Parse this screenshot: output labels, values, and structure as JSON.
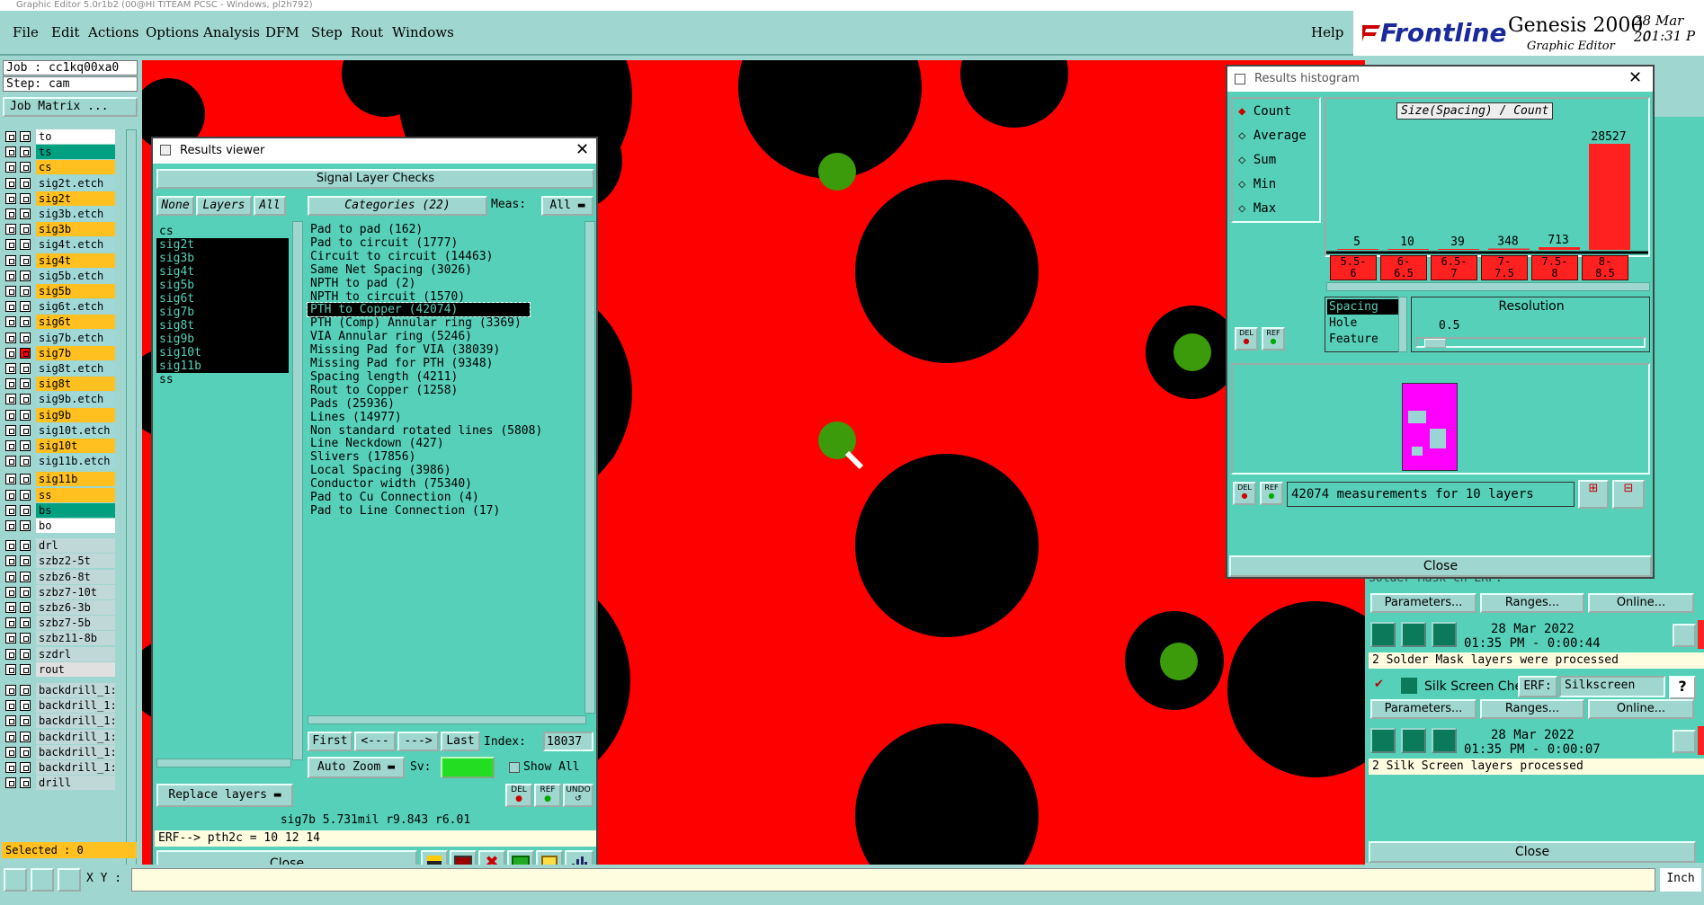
{
  "window_title": "Graphic Editor 5.0r1b2 (00@HI TITEAM PCSC - Windows, pl2h792)",
  "menu": [
    "File",
    "Edit",
    "Actions",
    "Options",
    "Analysis",
    "DFM",
    "Step",
    "Rout",
    "Windows"
  ],
  "help": "Help",
  "brand": {
    "logo": "Frontline",
    "product": "Genesis 2000",
    "subtitle": "Graphic Editor",
    "date": "28 Mar 20",
    "time": "01:31 P"
  },
  "job": {
    "job_label": "Job : cc1kq00xa0",
    "step_label": "Step: cam",
    "matrix_button": "Job Matrix ..."
  },
  "layers": [
    {
      "name": "to",
      "color": "#ffffff"
    },
    {
      "name": "ts",
      "color": "#00a080"
    },
    {
      "name": "cs",
      "color": "#ffc020"
    },
    {
      "name": "sig2t.etch",
      "color": "#a0d8d8"
    },
    {
      "name": "sig2t",
      "color": "#ffc020"
    },
    {
      "name": "sig3b.etch",
      "color": "#a0d8d8"
    },
    {
      "name": "sig3b",
      "color": "#ffc020"
    },
    {
      "name": "sig4t.etch",
      "color": "#a0d8d8"
    },
    {
      "name": "sig4t",
      "color": "#ffc020"
    },
    {
      "name": "sig5b.etch",
      "color": "#a0d8d8"
    },
    {
      "name": "sig5b",
      "color": "#ffc020"
    },
    {
      "name": "sig6t.etch",
      "color": "#a0d8d8"
    },
    {
      "name": "sig6t",
      "color": "#ffc020"
    },
    {
      "name": "sig7b.etch",
      "color": "#a0d8d8"
    },
    {
      "name": "sig7b",
      "color": "#ffc020"
    },
    {
      "name": "sig8t.etch",
      "color": "#a0d8d8"
    },
    {
      "name": "sig8t",
      "color": "#ffc020"
    },
    {
      "name": "sig9b.etch",
      "color": "#a0d8d8"
    },
    {
      "name": "sig9b",
      "color": "#ffc020"
    },
    {
      "name": "sig10t.etch",
      "color": "#a0d8d8"
    },
    {
      "name": "sig10t",
      "color": "#ffc020"
    },
    {
      "name": "sig11b.etch",
      "color": "#a0d8d8"
    },
    {
      "name": "sig11b",
      "color": "#ffc020"
    },
    {
      "name": "ss",
      "color": "#ffc020"
    },
    {
      "name": "bs",
      "color": "#00a080"
    },
    {
      "name": "bo",
      "color": "#ffffff"
    },
    {
      "name": "drl",
      "color": "#c0d8d8"
    },
    {
      "name": "szbz2-5t",
      "color": "#c0d8d8"
    },
    {
      "name": "szbz6-8t",
      "color": "#c0d8d8"
    },
    {
      "name": "szbz7-10t",
      "color": "#c0d8d8"
    },
    {
      "name": "szbz6-3b",
      "color": "#c0d8d8"
    },
    {
      "name": "szbz7-5b",
      "color": "#c0d8d8"
    },
    {
      "name": "szbz11-8b",
      "color": "#c0d8d8"
    },
    {
      "name": "szdrl",
      "color": "#c0d8d8"
    },
    {
      "name": "rout",
      "color": "#e0e0e0"
    },
    {
      "name": "backdrill_1:",
      "color": "#c0d8d8"
    },
    {
      "name": "backdrill_1:",
      "color": "#c0d8d8"
    },
    {
      "name": "backdrill_1:",
      "color": "#c0d8d8"
    },
    {
      "name": "backdrill_1:",
      "color": "#c0d8d8"
    },
    {
      "name": "backdrill_1:",
      "color": "#c0d8d8"
    },
    {
      "name": "backdrill_1:",
      "color": "#c0d8d8"
    },
    {
      "name": "drill",
      "color": "#c0d8d8"
    }
  ],
  "selected": "Selected : 0",
  "xy_label": "X Y :",
  "results_viewer": {
    "title": "Results viewer",
    "header": "Signal Layer Checks",
    "none_btn": "None",
    "layers_btn": "Layers",
    "all_btn": "All",
    "categories_btn": "Categories (22)",
    "meas_label": "Meas:",
    "meas_value": "All",
    "layer_list": [
      "cs",
      "sig2t",
      "sig3b",
      "sig4t",
      "sig5b",
      "sig6t",
      "sig7b",
      "sig8t",
      "sig9b",
      "sig10t",
      "sig11b",
      "ss"
    ],
    "categories": [
      "Pad to pad (162)",
      "Pad to circuit (1777)",
      "Circuit to circuit (14463)",
      "Same Net Spacing (3026)",
      "NPTH to pad (2)",
      "NPTH to circuit (1570)",
      "PTH to Copper (42074)",
      "PTH (Comp) Annular ring (3369)",
      "VIA Annular ring (5246)",
      "Missing Pad for VIA (38039)",
      "Missing Pad for PTH (9348)",
      "Spacing length (4211)",
      "Rout to Copper (1258)",
      "Pads (25936)",
      "Lines (14977)",
      "Non standard rotated lines (5808)",
      "Line Neckdown (427)",
      "Slivers (17856)",
      "Local Spacing (3986)",
      "Conductor width (75340)",
      "Pad to Cu Connection (4)",
      "Pad to Line Connection (17)"
    ],
    "selected_category": "PTH to Copper (42074)",
    "first": "First",
    "prev": "<---",
    "next": "--->",
    "last": "Last",
    "index_label": "Index:",
    "index_value": "18037",
    "auto_zoom": "Auto Zoom",
    "sv_label": "Sv:",
    "show_all": "Show All",
    "replace_layers": "Replace layers",
    "del": "DEL",
    "ref": "REF",
    "undo": "UNDO",
    "measure_line": "sig7b  5.731mil  r9.843  r6.01",
    "erf_line": "ERF--> pth2c = 10 12 14",
    "close": "Close"
  },
  "histogram": {
    "title": "Results histogram",
    "options": [
      "Count",
      "Average",
      "Sum",
      "Min",
      "Max"
    ],
    "selected_option": "Count",
    "chart_title": "Size(Spacing) / Count",
    "bars": [
      5,
      10,
      39,
      348,
      713,
      28527
    ],
    "bins": [
      "5.5-6",
      "6-6.5",
      "6.5-7",
      "7-7.5",
      "7.5-8",
      "8-8.5"
    ],
    "mode_options": [
      "Spacing",
      "Hole",
      "Feature"
    ],
    "resolution_label": "Resolution",
    "resolution_value": "0.5",
    "del": "DEL",
    "ref": "REF",
    "summary": "42074 measurements for 10 layers",
    "close": "Close"
  },
  "right_panel": {
    "solder_partial": "Solder Mask Ch  ERF:",
    "params": "Parameters...",
    "ranges": "Ranges...",
    "online": "Online...",
    "sm_date": "28 Mar 2022",
    "sm_time": "01:35 PM - 0:00:44",
    "sm_status": "2 Solder Mask layers were processed",
    "silk_name": "Silk Screen Che",
    "erf_label": "ERF:",
    "silk_erf": "Silkscreen",
    "ss_date": "28 Mar 2022",
    "ss_time": "01:35 PM - 0:00:07",
    "ss_status": "2 Silk Screen layers processed",
    "close": "Close",
    "inch": "Inch"
  },
  "colors": {
    "board_red": "#ff0000",
    "pad_green": "#3c9b0a",
    "panel_teal": "#56d0b8",
    "menu_teal": "#9fd6cf",
    "highlight_yellow": "#ffc020"
  }
}
